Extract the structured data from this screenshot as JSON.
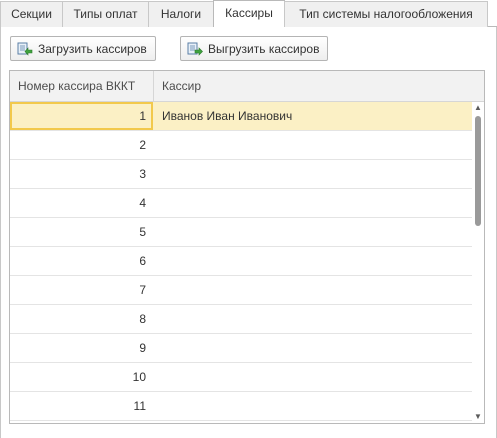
{
  "tabs": [
    {
      "label": "Секции",
      "active": false
    },
    {
      "label": "Типы оплат",
      "active": false
    },
    {
      "label": "Налоги",
      "active": false
    },
    {
      "label": "Кассиры",
      "active": true
    },
    {
      "label": "Тип системы налогообложения",
      "active": false
    }
  ],
  "toolbar": {
    "load_label": "Загрузить кассиров",
    "load_icon": "import-icon",
    "unload_label": "Выгрузить кассиров",
    "unload_icon": "export-icon"
  },
  "table": {
    "columns": [
      "Номер кассира ВККТ",
      "Кассир"
    ],
    "rows": [
      {
        "num": "1",
        "name": "Иванов Иван Иванович",
        "selected": true
      },
      {
        "num": "2",
        "name": ""
      },
      {
        "num": "3",
        "name": ""
      },
      {
        "num": "4",
        "name": ""
      },
      {
        "num": "5",
        "name": ""
      },
      {
        "num": "6",
        "name": ""
      },
      {
        "num": "7",
        "name": ""
      },
      {
        "num": "8",
        "name": ""
      },
      {
        "num": "9",
        "name": ""
      },
      {
        "num": "10",
        "name": ""
      },
      {
        "num": "11",
        "name": ""
      }
    ]
  },
  "colors": {
    "selection": "#fbf0c5",
    "selection_border": "#f2c94c"
  }
}
